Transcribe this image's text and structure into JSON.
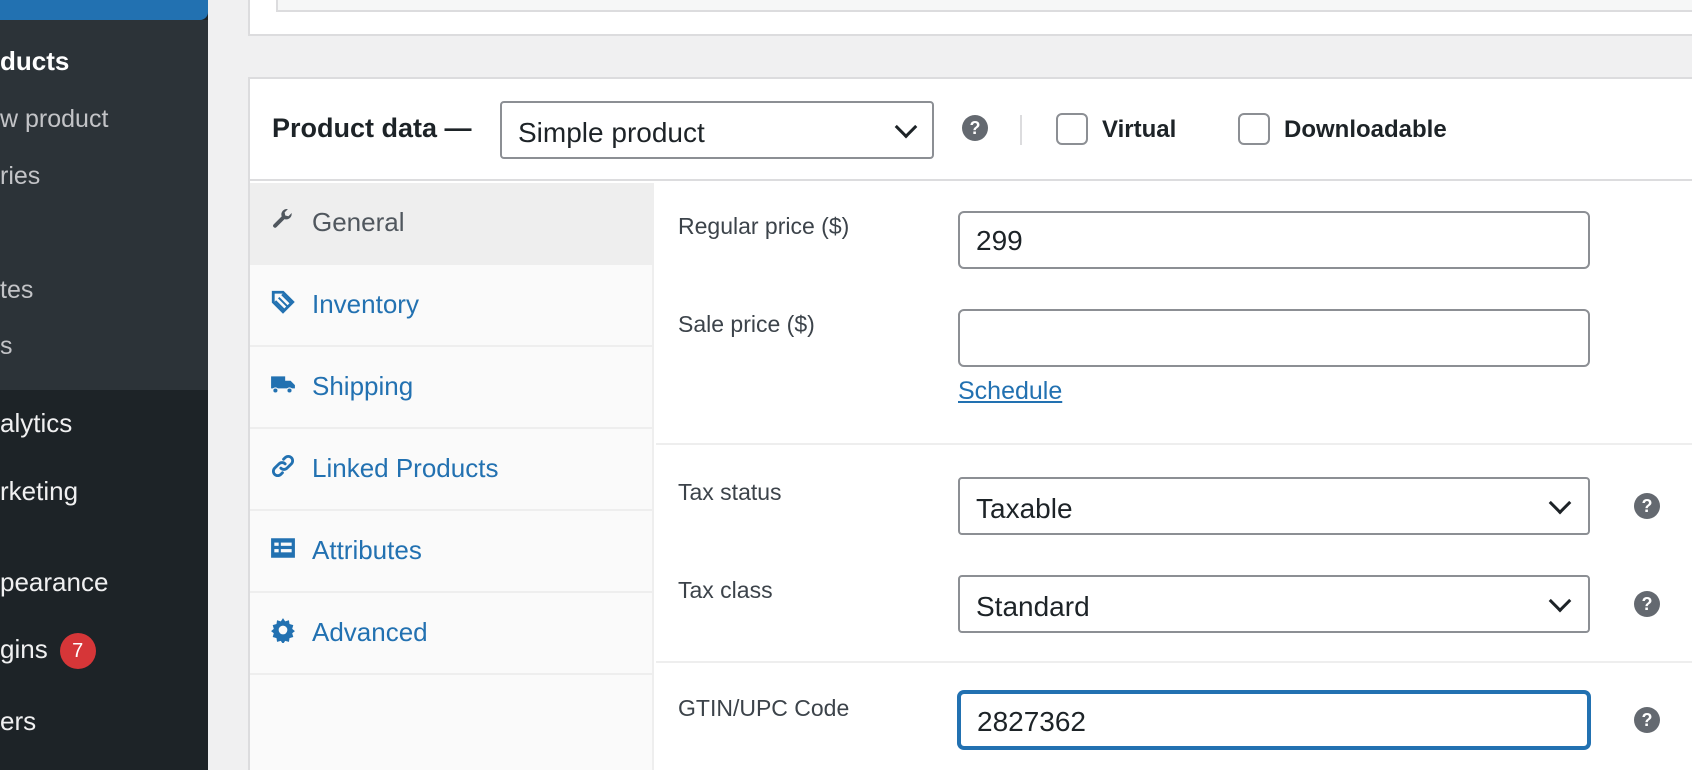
{
  "sidebar": {
    "items": [
      {
        "label": "ducts"
      },
      {
        "label": "w product"
      },
      {
        "label": "ries"
      },
      {
        "label": "tes"
      },
      {
        "label": "s"
      },
      {
        "label": "alytics"
      },
      {
        "label": "rketing"
      },
      {
        "label": "pearance"
      },
      {
        "label": "gins"
      },
      {
        "label": "ers"
      }
    ],
    "plugins_badge": "7"
  },
  "product_data": {
    "title": "Product data —",
    "type_select": "Simple product",
    "virtual_label": "Virtual",
    "downloadable_label": "Downloadable",
    "help_glyph": "?"
  },
  "tabs": [
    {
      "label": "General",
      "icon": "wrench-icon",
      "active": true
    },
    {
      "label": "Inventory",
      "icon": "tag-icon"
    },
    {
      "label": "Shipping",
      "icon": "truck-icon"
    },
    {
      "label": "Linked Products",
      "icon": "link-icon"
    },
    {
      "label": "Attributes",
      "icon": "list-card-icon"
    },
    {
      "label": "Advanced",
      "icon": "gear-icon"
    }
  ],
  "fields": {
    "regular_price_label": "Regular price ($)",
    "regular_price_value": "299",
    "sale_price_label": "Sale price ($)",
    "sale_price_value": "",
    "schedule_link": "Schedule",
    "tax_status_label": "Tax status",
    "tax_status_value": "Taxable",
    "tax_class_label": "Tax class",
    "tax_class_value": "Standard",
    "gtin_label": "GTIN/UPC Code",
    "gtin_value": "2827362"
  },
  "colors": {
    "accent": "#2271b1",
    "sidebar_bg": "#1d2327",
    "badge": "#d63638"
  }
}
